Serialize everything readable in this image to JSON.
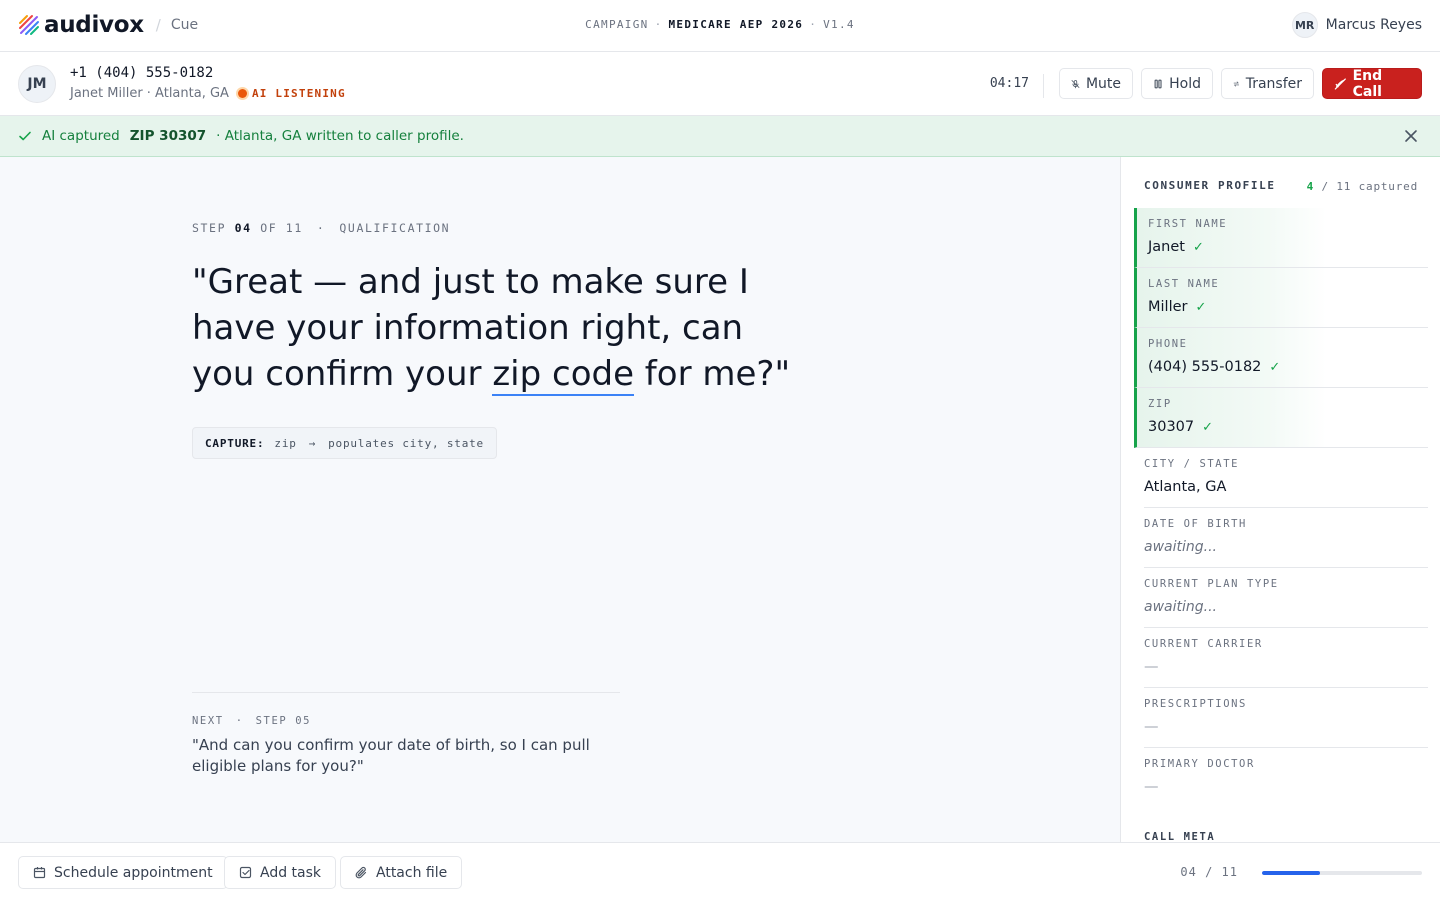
{
  "brand": {
    "name": "audivox",
    "product": "Cue"
  },
  "campaign": {
    "prefix": "CAMPAIGN",
    "name": "MEDICARE AEP 2026",
    "version": "V1.4"
  },
  "agent": {
    "initials": "MR",
    "name": "Marcus Reyes"
  },
  "call": {
    "caller_initials": "JM",
    "phone": "+1 (404) 555-0182",
    "caller_meta": "Janet Miller · Atlanta, GA",
    "ai_status": "AI LISTENING",
    "timer": "04:17",
    "controls": {
      "mute": "Mute",
      "hold": "Hold",
      "transfer": "Transfer",
      "end": "End Call"
    }
  },
  "banner": {
    "prefix": "AI captured",
    "highlight": "ZIP 30307",
    "suffix": "· Atlanta, GA written to caller profile."
  },
  "script": {
    "step_word": "STEP",
    "step_num": "04",
    "step_total": "OF 11",
    "section": "QUALIFICATION",
    "text_before": "\"Great — and just to make sure I have your information right, can you confirm your ",
    "text_highlight": "zip code",
    "text_after": " for me?\"",
    "capture_label": "CAPTURE:",
    "capture_field": "zip",
    "capture_effect": "populates city, state",
    "next_label": "NEXT",
    "next_step": "STEP 05",
    "next_text": "\"And can you confirm your date of birth, so I can pull eligible plans for you?\""
  },
  "profile": {
    "title": "CONSUMER PROFILE",
    "captured_count": "4",
    "captured_total": "/ 11 captured",
    "fields": [
      {
        "label": "FIRST NAME",
        "value": "Janet",
        "state": "done",
        "check": "✓"
      },
      {
        "label": "LAST NAME",
        "value": "Miller",
        "state": "done",
        "check": "✓"
      },
      {
        "label": "PHONE",
        "value": "(404) 555-0182",
        "state": "done",
        "check": "✓"
      },
      {
        "label": "ZIP",
        "value": "30307",
        "state": "done",
        "check": "✓"
      },
      {
        "label": "CITY / STATE",
        "value": "Atlanta, GA",
        "state": "filled"
      },
      {
        "label": "DATE OF BIRTH",
        "value": "awaiting...",
        "state": "waiting"
      },
      {
        "label": "CURRENT PLAN TYPE",
        "value": "awaiting...",
        "state": "waiting"
      },
      {
        "label": "CURRENT CARRIER",
        "value": "—",
        "state": "empty"
      },
      {
        "label": "PRESCRIPTIONS",
        "value": "—",
        "state": "empty"
      },
      {
        "label": "PRIMARY DOCTOR",
        "value": "—",
        "state": "empty"
      }
    ],
    "meta_title": "CALL META"
  },
  "footer": {
    "schedule": "Schedule appointment",
    "add_task": "Add task",
    "attach": "Attach file",
    "progress_text": "04 / 11",
    "progress_fraction": 0.364
  },
  "colors": {
    "accent": "#2563eb",
    "success": "#16a34a",
    "danger": "#c9211e",
    "listening": "#ea580c"
  }
}
